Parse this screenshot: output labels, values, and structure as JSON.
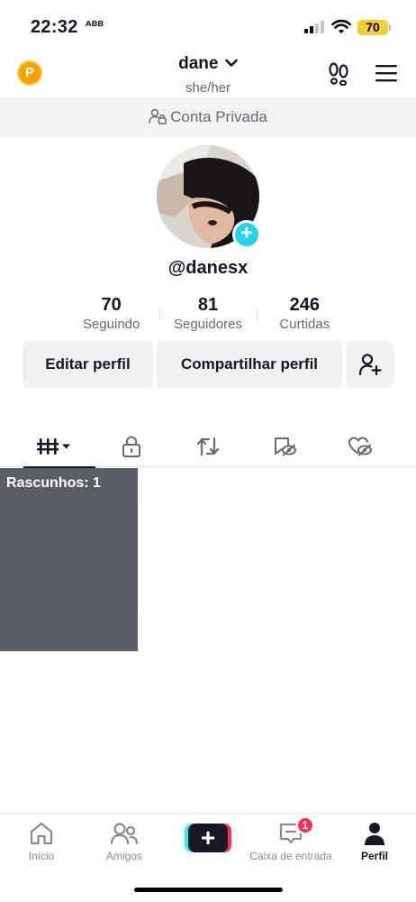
{
  "status_bar": {
    "time": "22:32",
    "time_glyph": "ᴀʙʙ",
    "battery": "70",
    "battery_color": "#f5cf2d"
  },
  "header": {
    "coin_label": "P",
    "username": "dane",
    "pronouns": "she/her",
    "icons": [
      "coin-icon",
      "chevron-down-icon",
      "footprint-icon",
      "menu-icon"
    ]
  },
  "private_banner": {
    "label": "Conta Privada",
    "icon": "lock-person-icon"
  },
  "profile": {
    "handle": "@danesx",
    "avatar_badge": "+",
    "stats": [
      {
        "value": "70",
        "label": "Seguindo"
      },
      {
        "value": "81",
        "label": "Seguidores"
      },
      {
        "value": "246",
        "label": "Curtidas"
      }
    ]
  },
  "actions": {
    "edit": "Editar perfil",
    "share": "Compartilhar perfil",
    "add_friends_icon": "person-add-icon"
  },
  "tabs": [
    {
      "icon": "videos-grid-icon",
      "active": true
    },
    {
      "icon": "lock-icon",
      "active": false
    },
    {
      "icon": "repost-icon",
      "active": false
    },
    {
      "icon": "favorites-hidden-icon",
      "active": false
    },
    {
      "icon": "liked-hidden-icon",
      "active": false
    }
  ],
  "drafts": {
    "label": "Rascunhos: 1"
  },
  "bottom_nav": {
    "items": [
      {
        "label": "Início",
        "icon": "home-icon"
      },
      {
        "label": "Amigos",
        "icon": "friends-icon"
      },
      {
        "label": "",
        "icon": "create-icon"
      },
      {
        "label": "Caixa de entrada",
        "icon": "inbox-icon",
        "badge": "1"
      },
      {
        "label": "Perfil",
        "icon": "profile-icon",
        "active": true
      }
    ],
    "create_label": "+",
    "accent_cyan": "#25f4ee",
    "accent_red": "#fe2c55"
  }
}
